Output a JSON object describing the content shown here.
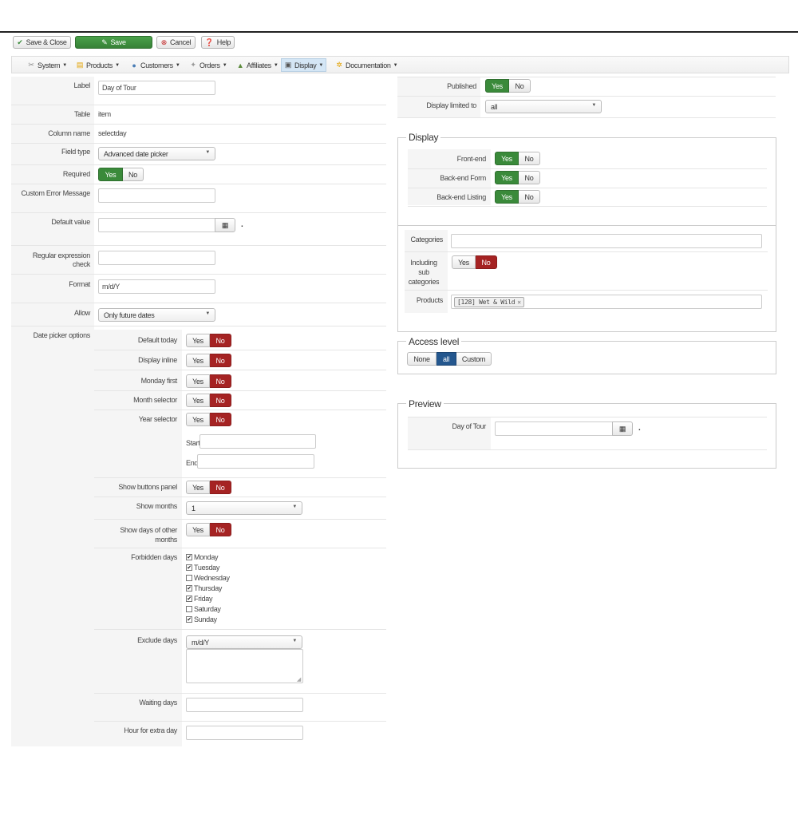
{
  "toolbar": {
    "save_close": "Save & Close",
    "save": "Save",
    "cancel": "Cancel",
    "help": "Help"
  },
  "menu": {
    "system": "System",
    "products": "Products",
    "customers": "Customers",
    "orders": "Orders",
    "affiliates": "Affiliates",
    "display": "Display",
    "documentation": "Documentation"
  },
  "form": {
    "label_label": "Label",
    "label_value": "Day of Tour",
    "table_label": "Table",
    "table_value": "item",
    "column_label": "Column name",
    "column_value": "selectday",
    "fieldtype_label": "Field type",
    "fieldtype_value": "Advanced date picker",
    "required_label": "Required",
    "custom_error_label": "Custom Error Message",
    "default_value_label": "Default value",
    "regex_label_1": "Regular expression",
    "regex_label_2": "check",
    "format_label": "Format",
    "format_value": "m/d/Y",
    "allow_label": "Allow",
    "allow_value": "Only future dates",
    "datepicker_label": "Date picker options"
  },
  "toggle": {
    "yes": "Yes",
    "no": "No"
  },
  "dp": {
    "default_today": "Default today",
    "display_inline": "Display inline",
    "monday_first": "Monday first",
    "month_selector": "Month selector",
    "year_selector": "Year selector",
    "start": "Start",
    "end": "End",
    "show_buttons_panel": "Show buttons panel",
    "show_months": "Show months",
    "show_months_value": "1",
    "show_days_1": "Show days of other",
    "show_days_2": "months",
    "forbidden_days": "Forbidden days",
    "days": [
      {
        "name": "Monday",
        "checked": true
      },
      {
        "name": "Tuesday",
        "checked": true
      },
      {
        "name": "Wednesday",
        "checked": false
      },
      {
        "name": "Thursday",
        "checked": true
      },
      {
        "name": "Friday",
        "checked": true
      },
      {
        "name": "Saturday",
        "checked": false
      },
      {
        "name": "Sunday",
        "checked": true
      }
    ],
    "exclude_days": "Exclude days",
    "exclude_days_value": "m/d/Y",
    "waiting_days": "Waiting days",
    "hour_extra_day": "Hour for extra day"
  },
  "right": {
    "published": "Published",
    "display_limited": "Display limited to",
    "display_limited_value": "all",
    "display_legend": "Display",
    "frontend": "Front-end",
    "backend_form": "Back-end Form",
    "backend_listing": "Back-end Listing",
    "categories": "Categories",
    "including_1": "Including",
    "including_2": "sub",
    "including_3": "categories",
    "products": "Products",
    "product_tag": "[128] Wet & Wild",
    "access_legend": "Access level",
    "access_none": "None",
    "access_all": "all",
    "access_custom": "Custom",
    "preview_legend": "Preview",
    "preview_label": "Day of Tour"
  },
  "colors": {
    "green": "#3a8a3a",
    "red": "#a52323",
    "blue": "#24578e"
  }
}
